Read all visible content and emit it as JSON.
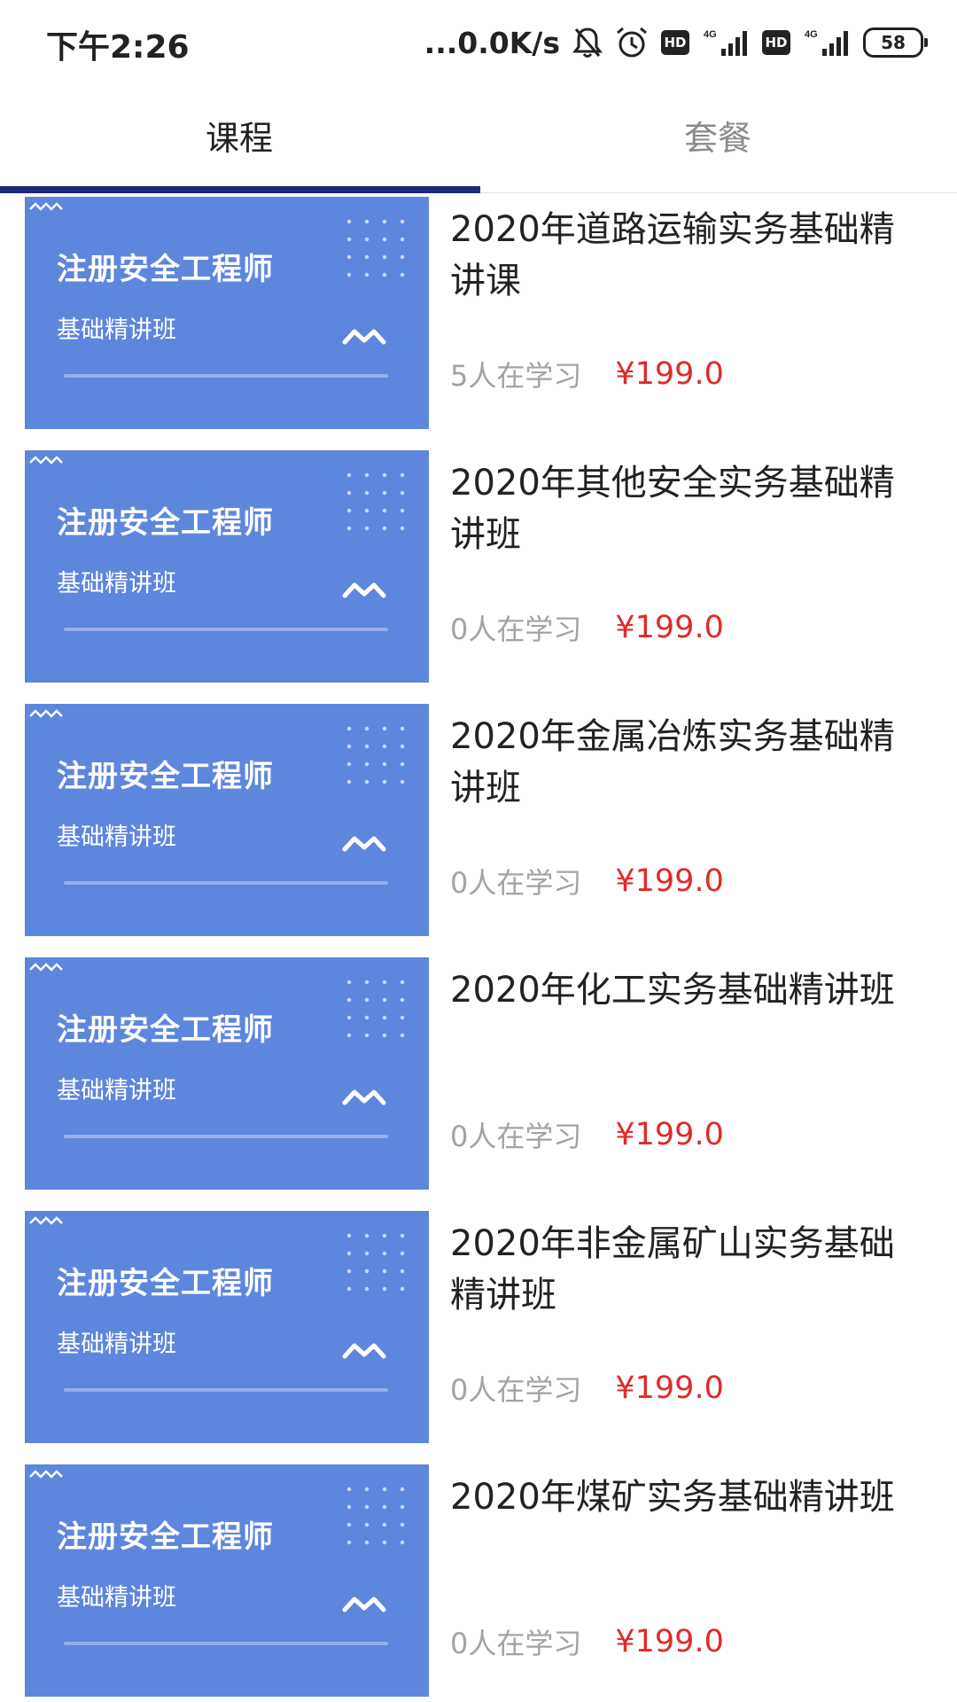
{
  "status_bar": {
    "time": "下午2:26",
    "net_speed": "...0.0K/s",
    "hd_label_1": "HD",
    "hd_label_2": "HD",
    "battery_level": "58",
    "icons": [
      "bell-muted-icon",
      "alarm-icon",
      "hd-icon",
      "signal-4g-icon",
      "hd-icon",
      "signal-4g-icon",
      "battery-icon"
    ]
  },
  "tabs": [
    {
      "label": "课程",
      "active": true
    },
    {
      "label": "套餐",
      "active": false
    }
  ],
  "colors": {
    "accent": "#1f2a7a",
    "thumbnail_bg": "#5d86dd",
    "price": "#e02a2a",
    "muted_text": "#a3a3a3"
  },
  "courses": [
    {
      "thumb_title": "注册安全工程师",
      "thumb_subtitle": "基础精讲班",
      "title": "2020年道路运输实务基础精讲课",
      "learners": "5人在学习",
      "price": "¥199.0"
    },
    {
      "thumb_title": "注册安全工程师",
      "thumb_subtitle": "基础精讲班",
      "title": "2020年其他安全实务基础精讲班",
      "learners": "0人在学习",
      "price": "¥199.0"
    },
    {
      "thumb_title": "注册安全工程师",
      "thumb_subtitle": "基础精讲班",
      "title": "2020年金属冶炼实务基础精讲班",
      "learners": "0人在学习",
      "price": "¥199.0"
    },
    {
      "thumb_title": "注册安全工程师",
      "thumb_subtitle": "基础精讲班",
      "title": "2020年化工实务基础精讲班",
      "learners": "0人在学习",
      "price": "¥199.0"
    },
    {
      "thumb_title": "注册安全工程师",
      "thumb_subtitle": "基础精讲班",
      "title": "2020年非金属矿山实务基础精讲班",
      "learners": "0人在学习",
      "price": "¥199.0"
    },
    {
      "thumb_title": "注册安全工程师",
      "thumb_subtitle": "基础精讲班",
      "title": "2020年煤矿实务基础精讲班",
      "learners": "0人在学习",
      "price": "¥199.0"
    }
  ]
}
